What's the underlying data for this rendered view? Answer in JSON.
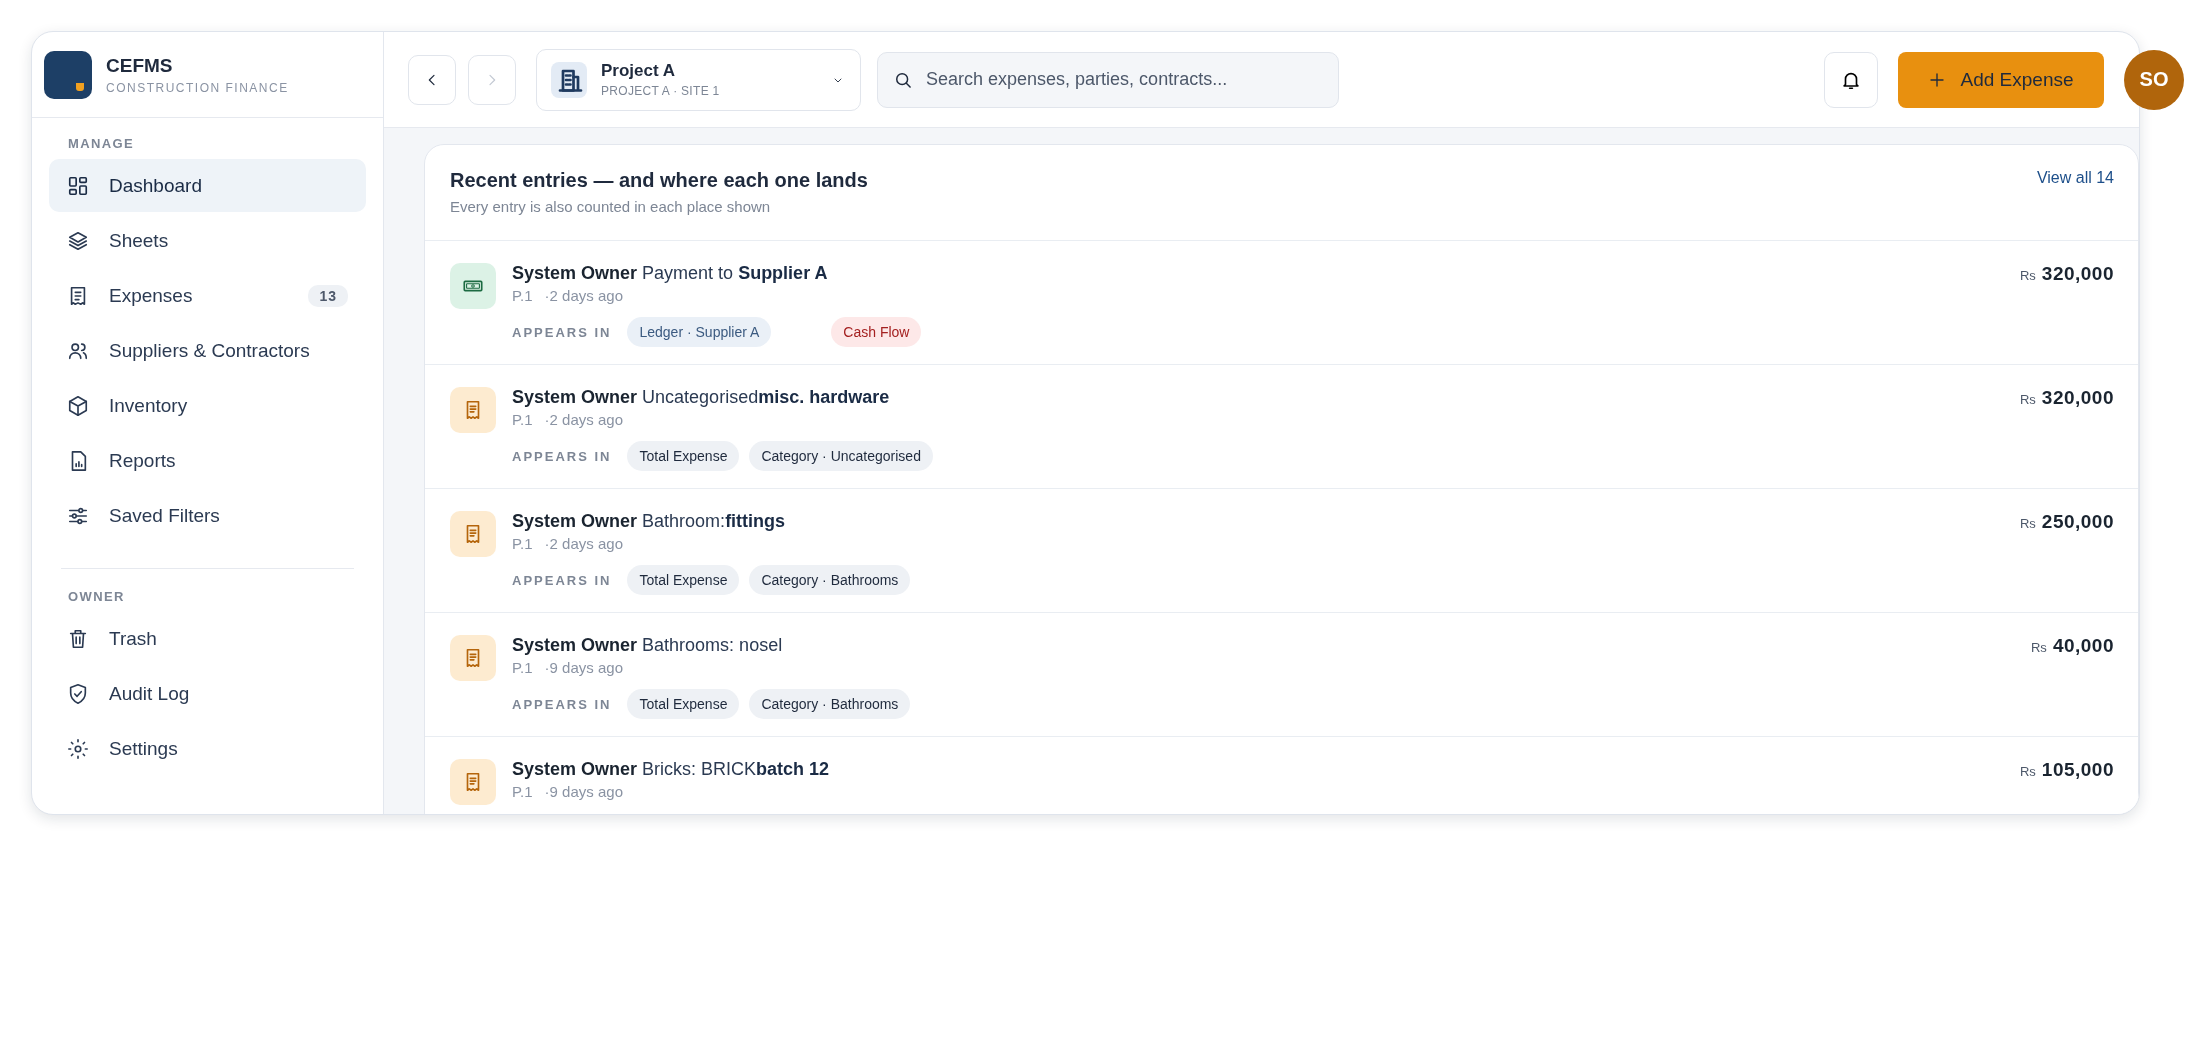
{
  "brand": {
    "name": "CEFMS",
    "tagline": "CONSTRUCTION FINANCE"
  },
  "sidebar": {
    "sections": [
      {
        "title": "MANAGE",
        "items": [
          {
            "label": "Dashboard",
            "selected": true
          },
          {
            "label": "Sheets",
            "selected": false
          },
          {
            "label": "Expenses",
            "selected": false,
            "badge": "13"
          },
          {
            "label": "Suppliers & Contractors",
            "selected": false
          },
          {
            "label": "Inventory",
            "selected": false
          },
          {
            "label": "Reports",
            "selected": false
          },
          {
            "label": "Saved Filters",
            "selected": false
          }
        ]
      },
      {
        "title": "OWNER",
        "items": [
          {
            "label": "Trash",
            "selected": false
          },
          {
            "label": "Audit Log",
            "selected": false
          },
          {
            "label": "Settings",
            "selected": false
          }
        ]
      }
    ]
  },
  "topbar": {
    "back_disabled": false,
    "forward_disabled": true,
    "project": {
      "name": "Project A",
      "site": "PROJECT A · SITE 1"
    },
    "search": {
      "placeholder": "Search expenses, parties, contracts..."
    },
    "add_button": "Add Expense",
    "avatar": "SO"
  },
  "card": {
    "title": "Recent entries — and where each one lands",
    "subtitle": "Every entry is also counted in each place shown",
    "view_all": "View all 14",
    "entries": [
      {
        "kind": "payment",
        "actor": "System Owner",
        "text": "Payment to **Supplier A**",
        "page": "P.1",
        "time": "·2 days ago",
        "appears_label": "APPEARS IN",
        "chips": [
          {
            "kind": "ledger",
            "label": "Ledger · Supplier A"
          },
          {
            "kind": "cashflow",
            "label": "Cash Flow"
          }
        ],
        "currency": "Rs",
        "amount": "320,000"
      },
      {
        "kind": "expense",
        "actor": "System Owner",
        "text": "Uncategorised**misc. hardware**",
        "page": "P.1",
        "time": "·2 days ago",
        "appears_label": "APPEARS IN",
        "chips": [
          {
            "kind": "neutral",
            "label": "Total Expense"
          },
          {
            "kind": "neutral",
            "label": "Category · Uncategorised"
          }
        ],
        "currency": "Rs",
        "amount": "320,000"
      },
      {
        "kind": "expense",
        "actor": "System Owner",
        "text": "Bathroom:**fittings**",
        "page": "P.1",
        "time": "·2 days ago",
        "appears_label": "APPEARS IN",
        "chips": [
          {
            "kind": "neutral",
            "label": "Total Expense"
          },
          {
            "kind": "neutral",
            "label": "Category · Bathrooms"
          }
        ],
        "currency": "Rs",
        "amount": "250,000"
      },
      {
        "kind": "expense",
        "actor": "System Owner",
        "text": "Bathrooms: nosel",
        "page": "P.1",
        "time": "·9 days ago",
        "appears_label": "APPEARS IN",
        "chips": [
          {
            "kind": "neutral",
            "label": "Total Expense"
          },
          {
            "kind": "neutral",
            "label": "Category · Bathrooms"
          }
        ],
        "currency": "Rs",
        "amount": "40,000"
      },
      {
        "kind": "expense",
        "actor": "System Owner",
        "text": "Bricks: BRICK**batch 12**",
        "page": "P.1",
        "time": "·9 days ago",
        "currency": "Rs",
        "amount": "105,000"
      }
    ]
  }
}
